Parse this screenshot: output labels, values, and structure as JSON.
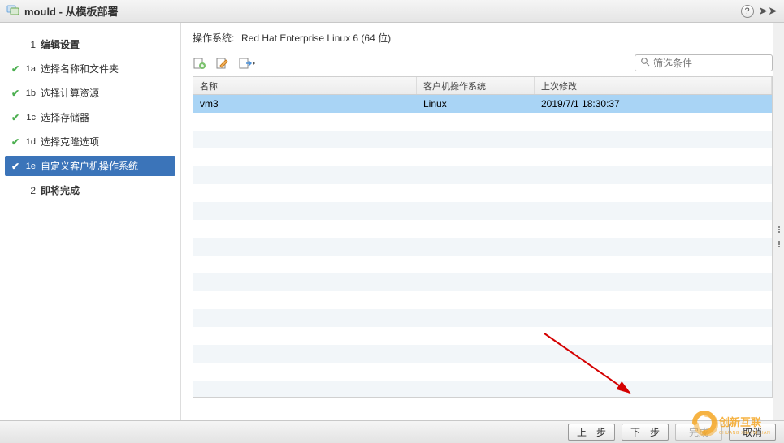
{
  "title": "mould - 从模板部署",
  "sidebar": {
    "steps": [
      {
        "num": "1",
        "label": "编辑设置",
        "type": "top",
        "check": false,
        "active": false
      },
      {
        "num": "1a",
        "label": "选择名称和文件夹",
        "type": "sub",
        "check": true,
        "active": false
      },
      {
        "num": "1b",
        "label": "选择计算资源",
        "type": "sub",
        "check": true,
        "active": false
      },
      {
        "num": "1c",
        "label": "选择存储器",
        "type": "sub",
        "check": true,
        "active": false
      },
      {
        "num": "1d",
        "label": "选择克隆选项",
        "type": "sub",
        "check": true,
        "active": false
      },
      {
        "num": "1e",
        "label": "自定义客户机操作系统",
        "type": "sub",
        "check": true,
        "active": true
      },
      {
        "num": "2",
        "label": "即将完成",
        "type": "top",
        "check": false,
        "active": false
      }
    ]
  },
  "main": {
    "os_label": "操作系统:",
    "os_value": "Red Hat Enterprise Linux 6 (64 位)",
    "filter_placeholder": "筛选条件",
    "columns": {
      "c1": "名称",
      "c2": "客户机操作系统",
      "c3": "上次修改"
    },
    "rows": [
      {
        "name": "vm3",
        "guest_os": "Linux",
        "modified": "2019/7/1 18:30:37",
        "selected": true
      }
    ]
  },
  "footer": {
    "back": "上一步",
    "next": "下一步",
    "finish": "完成",
    "cancel": "取消"
  },
  "watermark": "创新互联"
}
